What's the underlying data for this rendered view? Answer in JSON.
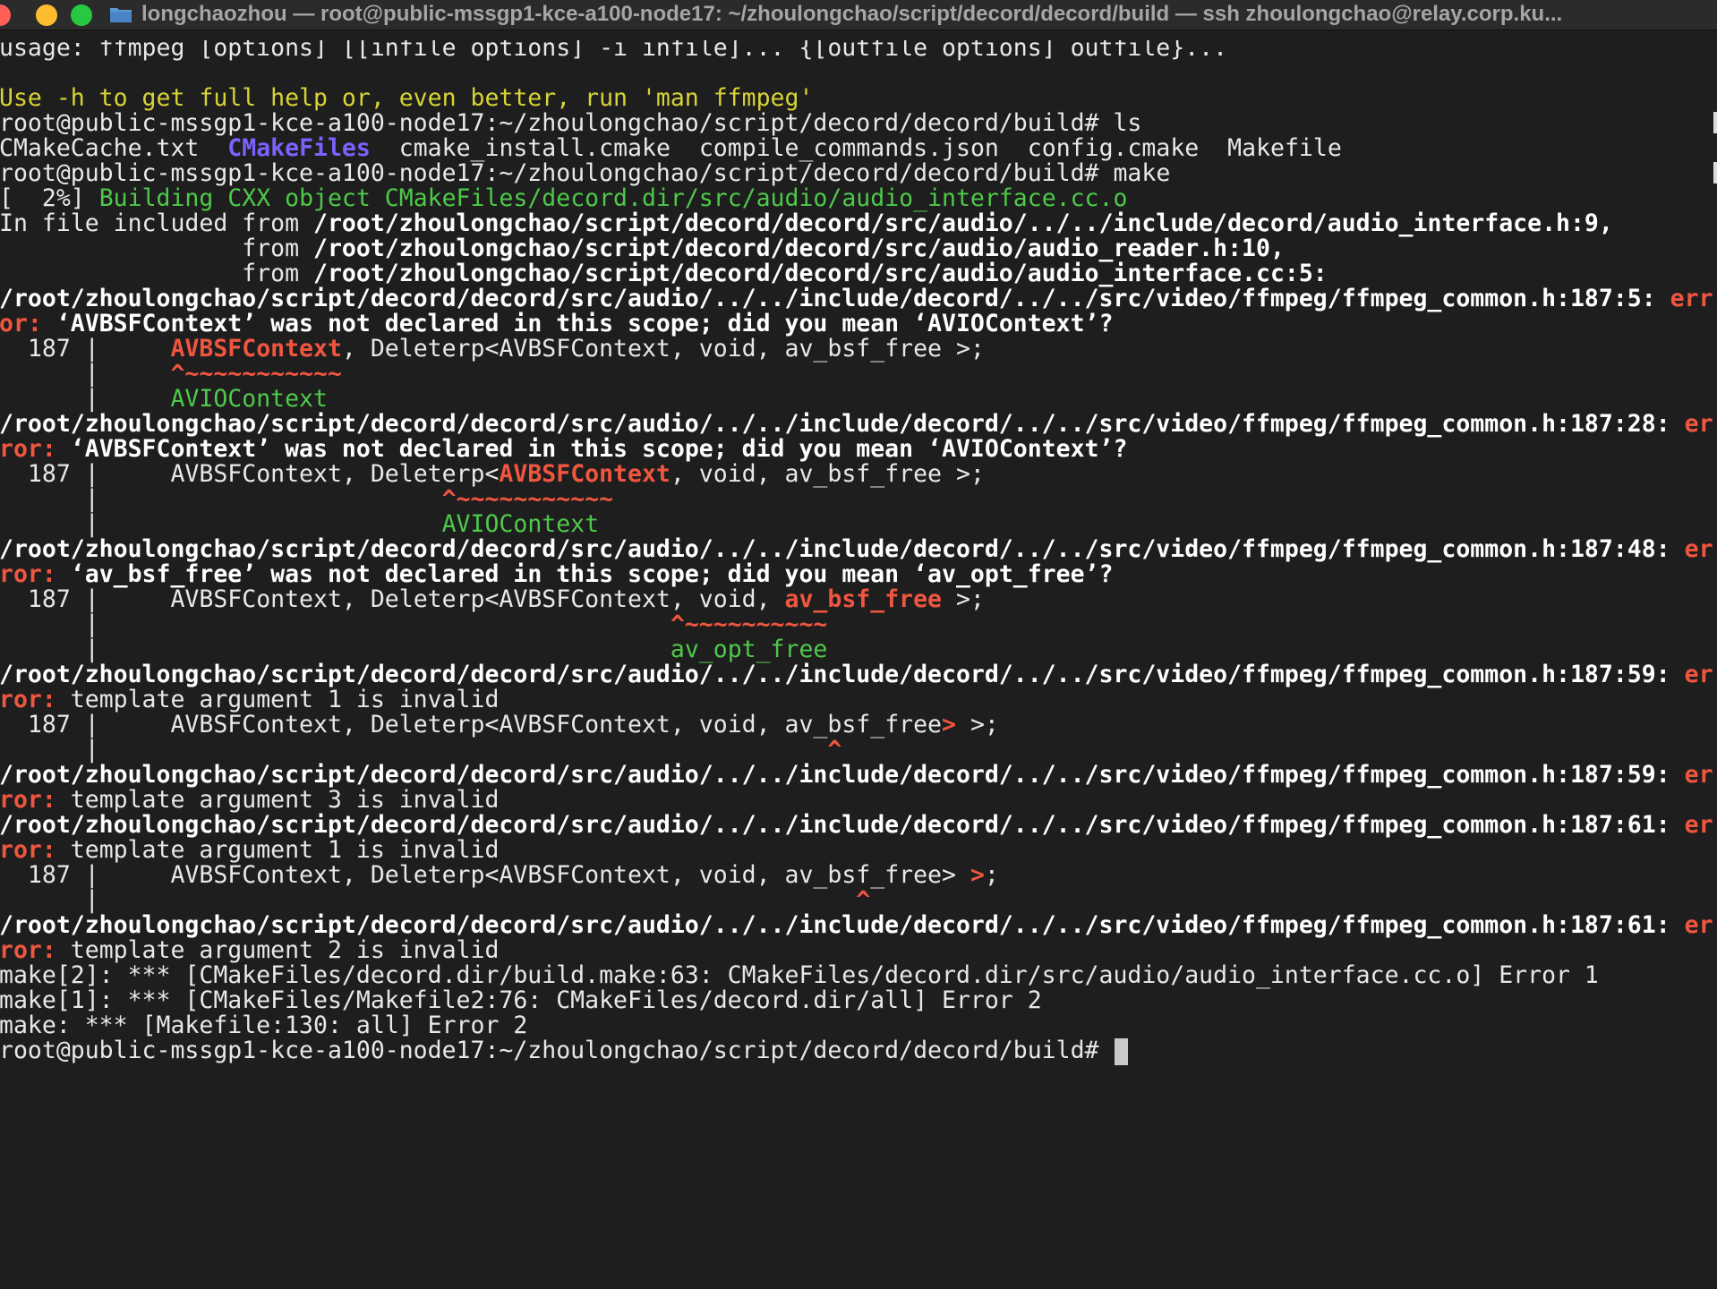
{
  "window": {
    "title": "longchaozhou — root@public-mssgp1-kce-a100-node17: ~/zhoulongchao/script/decord/decord/build — ssh zhoulongchao@relay.corp.ku..."
  },
  "colors": {
    "background": "#1e1e1e",
    "default_text": "#e8e8e8",
    "error_red": "#f0563f",
    "fix_green": "#4ec94a",
    "hint_yellow": "#d8d435",
    "dir_purple": "#7b62ff"
  },
  "terminal": {
    "l1": "usage: ffmpeg [options] [[infile options] -i infile]... {[outfile options] outfile}...",
    "l3": "Use -h to get full help or, even better, run 'man ffmpeg'",
    "prompt": "root@public-mssgp1-kce-a100-node17:~/zhoulongchao/script/decord/decord/build# ",
    "cmd_ls": "ls",
    "ls_items": [
      "CMakeCache.txt",
      "CMakeFiles",
      "cmake_install.cmake",
      "compile_commands.json",
      "config.cmake",
      "Makefile"
    ],
    "cmd_make": "make",
    "progress": "[  2%]",
    "progress_msg": "Building CXX object CMakeFiles/decord.dir/src/audio/audio_interface.cc.o",
    "incl_prefix_1": "In file included from ",
    "incl_path_1": "/root/zhoulongchao/script/decord/decord/src/audio/../../include/decord/audio_interface.h:9,",
    "incl_prefix_2": "                 from ",
    "incl_path_2": "/root/zhoulongchao/script/decord/decord/src/audio/audio_reader.h:10,",
    "incl_path_3": "/root/zhoulongchao/script/decord/decord/src/audio/audio_interface.cc:5:",
    "err_path_5": "/root/zhoulongchao/script/decord/decord/src/audio/../../include/decord/../../src/video/ffmpeg/ffmpeg_common.h:187:5:",
    "err_path_28": "/root/zhoulongchao/script/decord/decord/src/audio/../../include/decord/../../src/video/ffmpeg/ffmpeg_common.h:187:28:",
    "err_path_48": "/root/zhoulongchao/script/decord/decord/src/audio/../../include/decord/../../src/video/ffmpeg/ffmpeg_common.h:187:48:",
    "err_path_59": "/root/zhoulongchao/script/decord/decord/src/audio/../../include/decord/../../src/video/ffmpeg/ffmpeg_common.h:187:59:",
    "err_path_61": "/root/zhoulongchao/script/decord/decord/src/audio/../../include/decord/../../src/video/ffmpeg/ffmpeg_common.h:187:61:",
    "err_word_tail": " err",
    "err_word_tail_short": " er",
    "or_head": "or:",
    "ror_head": "ror:",
    "msg_not_declared_a": " ‘AVBSFContext’ was not declared in this scope; did you mean ‘AVIOContext’?",
    "msg_not_declared_b": " ‘av_bsf_free’ was not declared in this scope; did you mean ‘av_opt_free’?",
    "msg_tmpl_1": " template argument 1 is invalid",
    "msg_tmpl_2": " template argument 2 is invalid",
    "msg_tmpl_3": " template argument 3 is invalid",
    "gutter_num": "  187 | ",
    "gutter_bar": "      | ",
    "code_indent": "    ",
    "tok_avbsf": "AVBSFContext",
    "tok_deleterp": ", Deleterp<",
    "tok_void": ", void, ",
    "tok_free": "av_bsf_free",
    "tok_close": ">",
    "tok_tail": " >;",
    "tok_semicolon": ";",
    "caret_12": "^~~~~~~~~~~~",
    "caret_11": "^~~~~~~~~~~",
    "caret": "^",
    "fix_avio": "AVIOContext",
    "fix_opt": "av_opt_free",
    "make2": "make[2]: *** [CMakeFiles/decord.dir/build.make:63: CMakeFiles/decord.dir/src/audio/audio_interface.cc.o] Error 1",
    "make1": "make[1]: *** [CMakeFiles/Makefile2:76: CMakeFiles/decord.dir/all] Error 2",
    "make0": "make: *** [Makefile:130: all] Error 2"
  }
}
